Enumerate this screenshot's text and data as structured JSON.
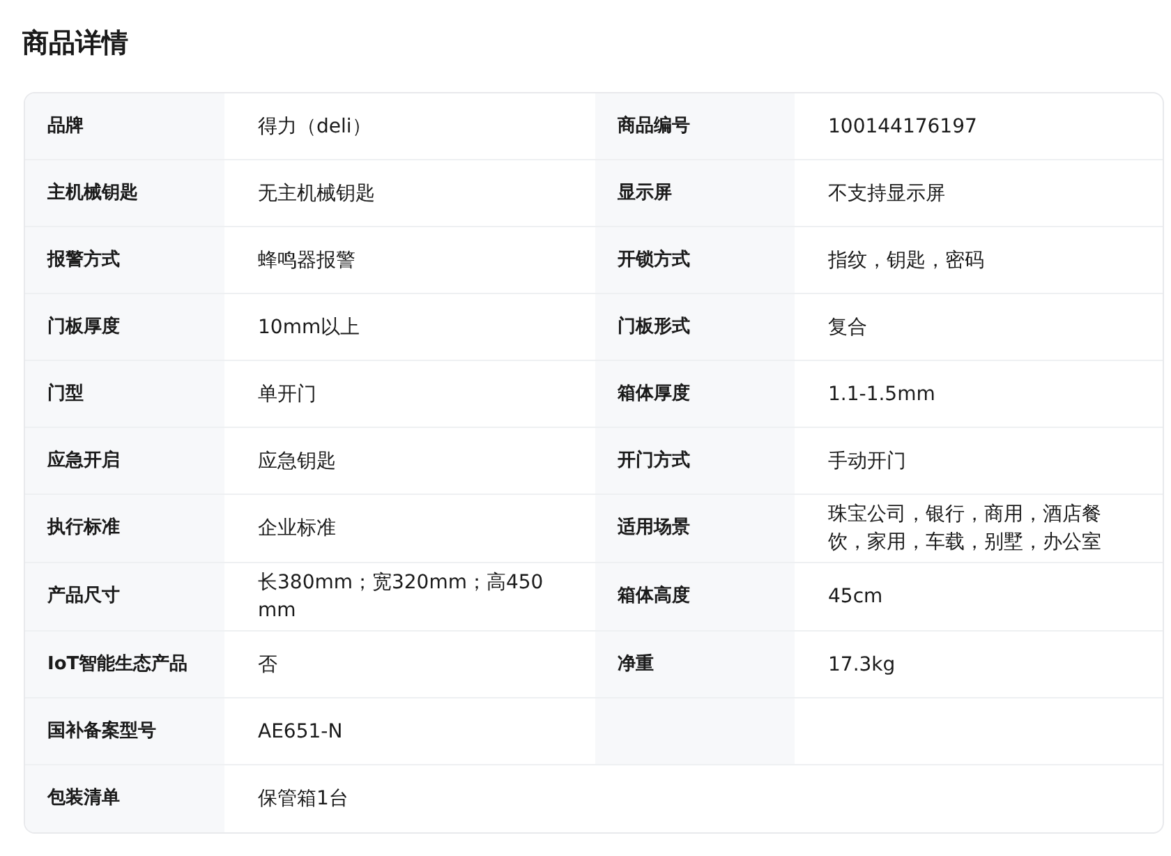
{
  "title": "商品详情",
  "rows": [
    {
      "kind": "pair",
      "cells": [
        {
          "label": "品牌",
          "value": "得力（deli）"
        },
        {
          "label": "商品编号",
          "value": "100144176197"
        }
      ]
    },
    {
      "kind": "pair",
      "cells": [
        {
          "label": "主机械钥匙",
          "value": "无主机械钥匙"
        },
        {
          "label": "显示屏",
          "value": "不支持显示屏"
        }
      ]
    },
    {
      "kind": "pair",
      "cells": [
        {
          "label": "报警方式",
          "value": "蜂鸣器报警"
        },
        {
          "label": "开锁方式",
          "value": "指纹，钥匙，密码"
        }
      ]
    },
    {
      "kind": "pair",
      "cells": [
        {
          "label": "门板厚度",
          "value": "10mm以上"
        },
        {
          "label": "门板形式",
          "value": "复合"
        }
      ]
    },
    {
      "kind": "pair",
      "cells": [
        {
          "label": "门型",
          "value": "单开门"
        },
        {
          "label": "箱体厚度",
          "value": "1.1-1.5mm"
        }
      ]
    },
    {
      "kind": "pair",
      "cells": [
        {
          "label": "应急开启",
          "value": "应急钥匙"
        },
        {
          "label": "开门方式",
          "value": "手动开门"
        }
      ]
    },
    {
      "kind": "pair",
      "cells": [
        {
          "label": "执行标准",
          "value": "企业标准"
        },
        {
          "label": "适用场景",
          "value": "珠宝公司，银行，商用，酒店餐饮，家用，车载，别墅，办公室"
        }
      ]
    },
    {
      "kind": "pair",
      "cells": [
        {
          "label": "产品尺寸",
          "value": "长380mm；宽320mm；高450mm"
        },
        {
          "label": "箱体高度",
          "value": "45cm"
        }
      ]
    },
    {
      "kind": "pair",
      "cells": [
        {
          "label": "IoT智能生态产品",
          "value": "否"
        },
        {
          "label": "净重",
          "value": "17.3kg"
        }
      ]
    },
    {
      "kind": "pair",
      "cells": [
        {
          "label": "国补备案型号",
          "value": "AE651-N"
        }
      ]
    },
    {
      "kind": "wide",
      "cells": [
        {
          "label": "包装清单",
          "value": "保管箱1台"
        }
      ]
    }
  ]
}
